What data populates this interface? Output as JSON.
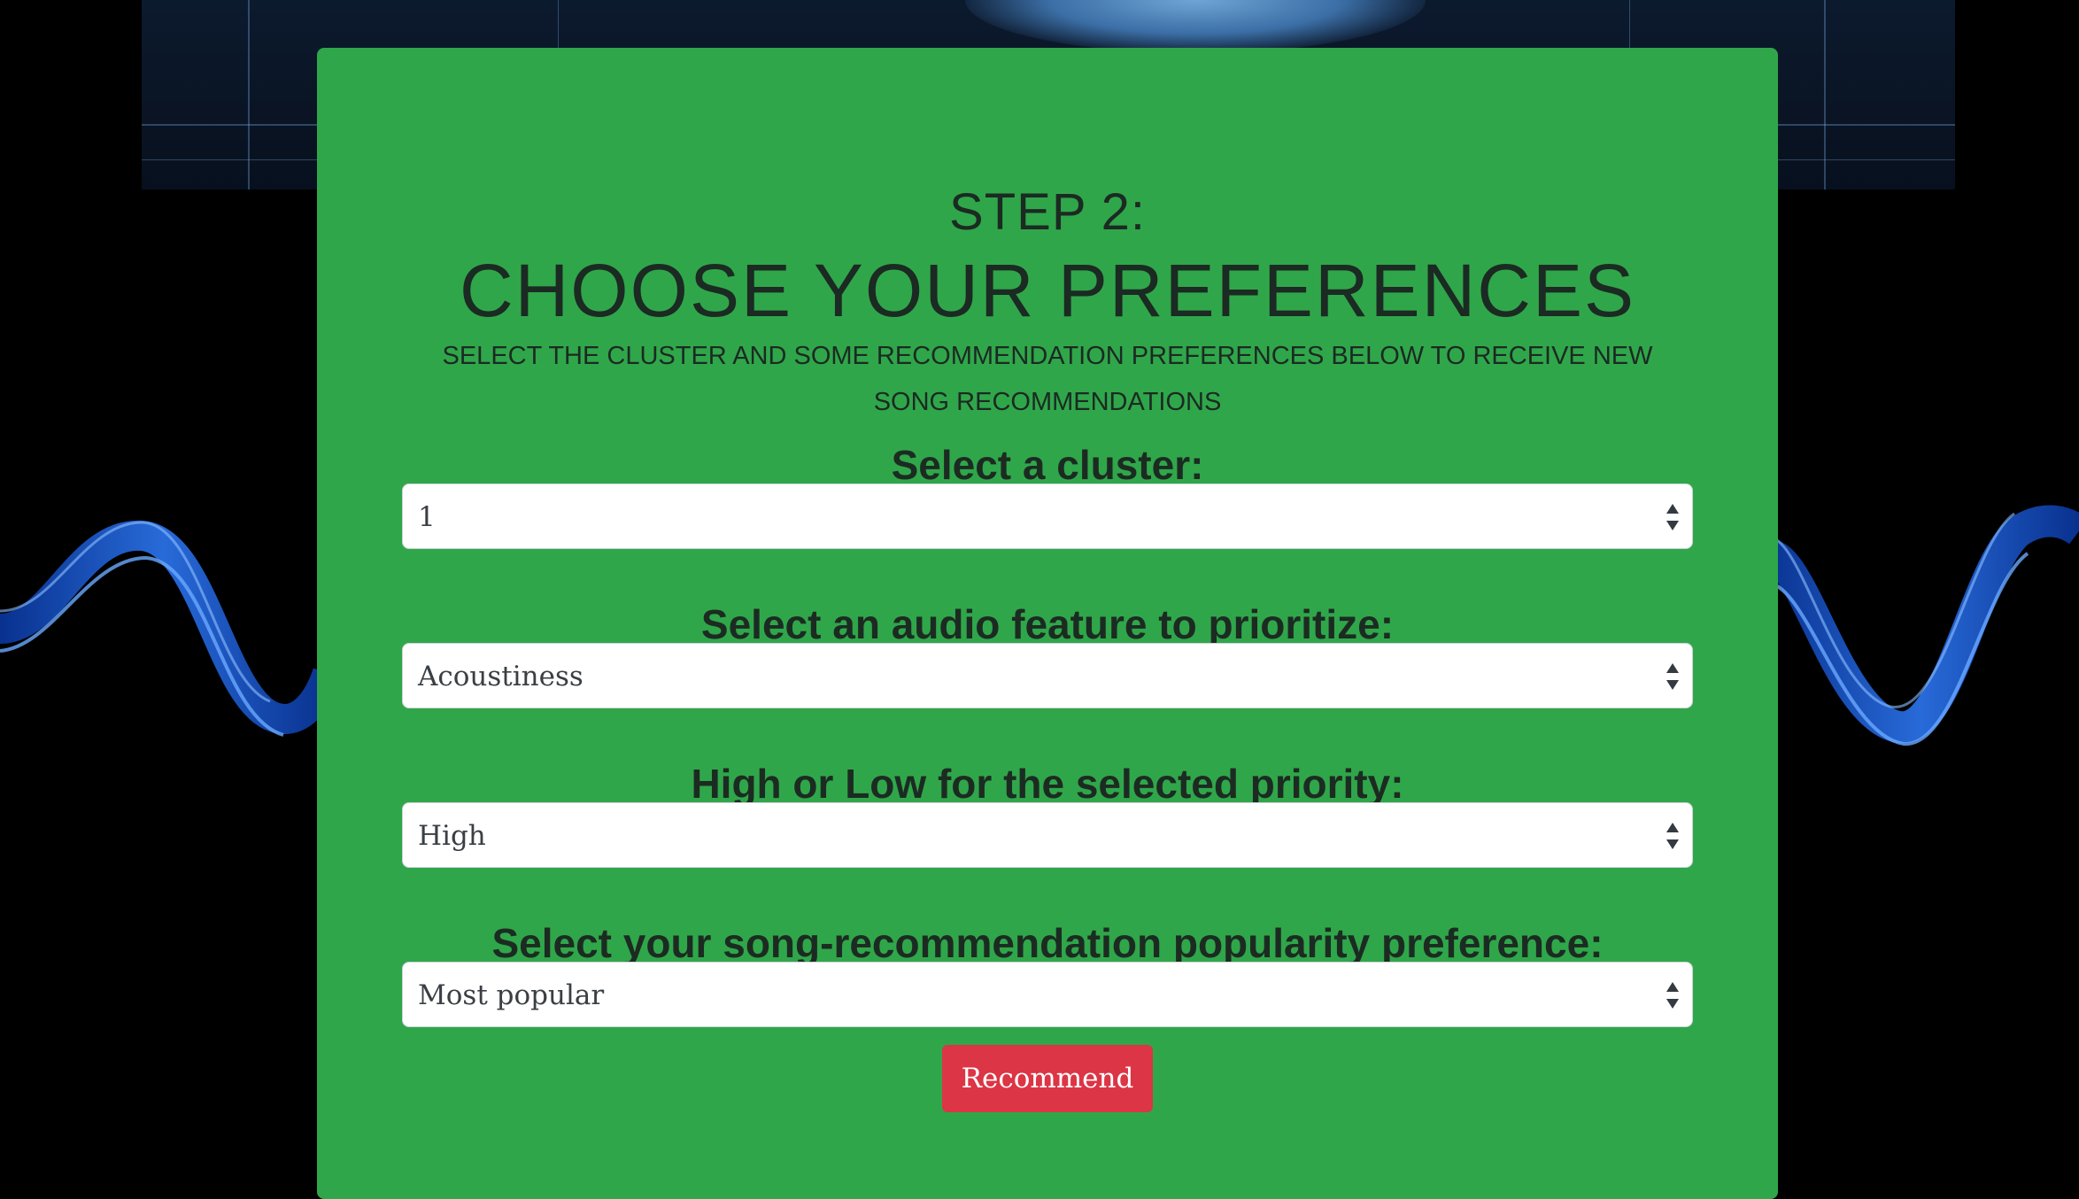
{
  "step": {
    "heading": "STEP 2:",
    "title": "CHOOSE YOUR PREFERENCES",
    "subtitle": "SELECT THE CLUSTER AND SOME RECOMMENDATION PREFERENCES BELOW TO RECEIVE NEW SONG RECOMMENDATIONS"
  },
  "form": {
    "cluster": {
      "label": "Select a cluster:",
      "value": "1"
    },
    "feature": {
      "label": "Select an audio feature to prioritize:",
      "value": "Acoustiness"
    },
    "level": {
      "label": "High or Low for the selected priority:",
      "value": "High"
    },
    "popularity": {
      "label": "Select your song-recommendation popularity preference:",
      "value": "Most popular"
    },
    "submit_label": "Recommend"
  },
  "colors": {
    "card": "#30a64a",
    "button": "#dc3545",
    "text": "#1b2a22"
  },
  "icons": {
    "select_arrow": "updown-arrows-icon",
    "background": "blue-wave-background"
  }
}
